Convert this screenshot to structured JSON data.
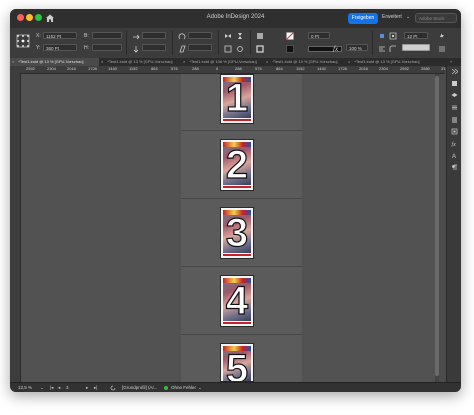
{
  "window": {
    "title": "Adobe InDesign 2024",
    "share_label": "Freigeben",
    "workspace_label": "Erweitert",
    "search_placeholder": "Adobe Stock"
  },
  "control_panel": {
    "x_label": "X:",
    "y_label": "Y:",
    "w_label": "B:",
    "h_label": "H:",
    "x_value": "1152 Pt",
    "y_value": "360 Pt",
    "w_value": "",
    "h_value": "",
    "stroke_weight": "0 Pt",
    "opacity": "100 %",
    "corner_value": "12 Pt"
  },
  "tabs": [
    {
      "label": "*Test1.indd @ 13 % [GPU-Vorschau]",
      "active": true
    },
    {
      "label": "*Test1.indd @ 13 % [GPU-Vorschau]",
      "active": false
    },
    {
      "label": "*Test1.indd @ 108 % [GPU-Vorschau]",
      "active": false
    },
    {
      "label": "*Test1.indd @ 13 % [GPU-Vorschau]",
      "active": false
    },
    {
      "label": "*Test1.indd @ 13 % [GPU-Vorschau]",
      "active": false
    }
  ],
  "ruler_h": [
    "2592",
    "2304",
    "2016",
    "1728",
    "1440",
    "1152",
    "864",
    "576",
    "288",
    "0",
    "288",
    "576",
    "864",
    "1152",
    "1440",
    "1728",
    "2016",
    "2304",
    "2592",
    "2880",
    "3168"
  ],
  "pages": [
    {
      "number": "1"
    },
    {
      "number": "2"
    },
    {
      "number": "3"
    },
    {
      "number": "4"
    },
    {
      "number": "5"
    }
  ],
  "status": {
    "zoom": "12,5 %",
    "page": "3",
    "master": "[Grundprofil] (Ar...",
    "preflight": "Ohne Fehler"
  },
  "colors": {
    "accent": "#1473e6",
    "preflight_ok": "#3dba3d"
  }
}
